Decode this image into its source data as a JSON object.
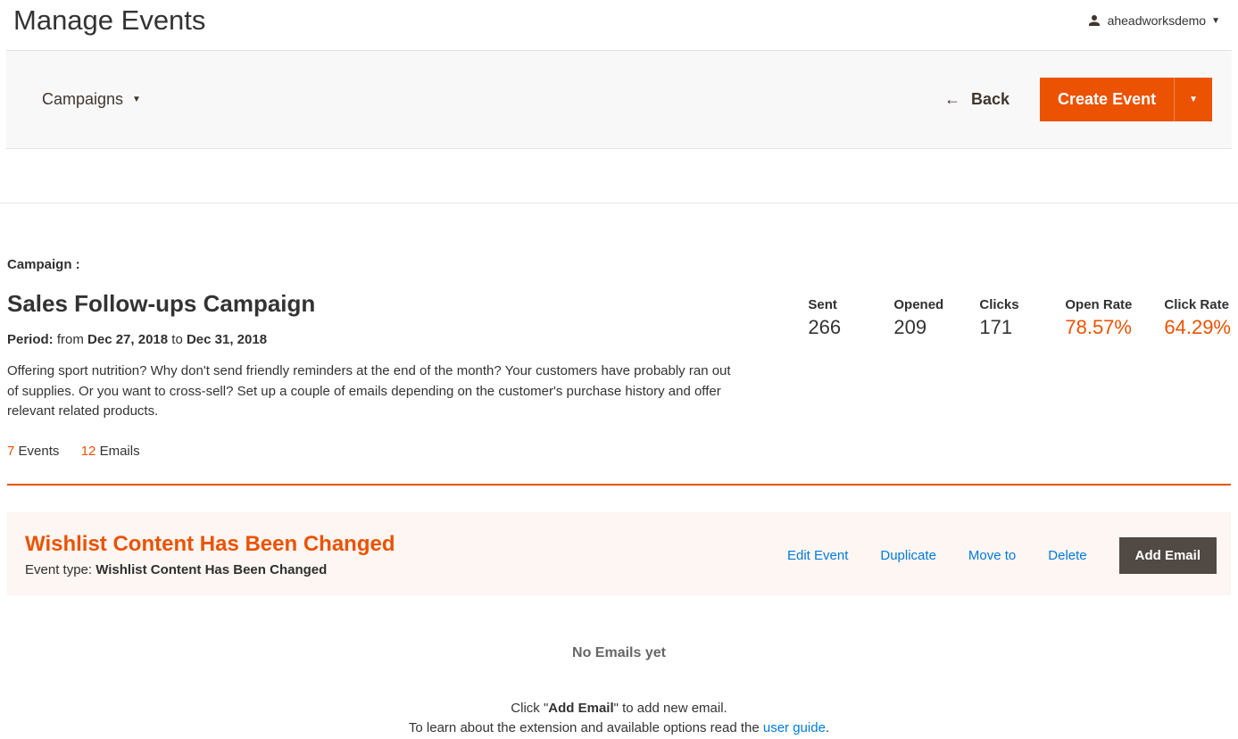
{
  "header": {
    "title": "Manage Events",
    "user": "aheadworksdemo"
  },
  "toolbar": {
    "campaigns_label": "Campaigns",
    "back_label": "Back",
    "create_label": "Create Event"
  },
  "campaign": {
    "label": "Campaign :",
    "name": "Sales Follow-ups Campaign",
    "period_label": "Period:",
    "period_from_word": "from",
    "period_from": "Dec 27, 2018",
    "period_to_word": "to",
    "period_to": "Dec 31, 2018",
    "description": "Offering sport nutrition? Why don't send friendly reminders at the end of the month? Your customers have probably ran out of supplies. Or you want to cross-sell? Set up a couple of emails depending on the customer's purchase history and offer relevant related products.",
    "events_count": "7",
    "events_word": "Events",
    "emails_count": "12",
    "emails_word": "Emails"
  },
  "stats": {
    "sent_label": "Sent",
    "sent_value": "266",
    "opened_label": "Opened",
    "opened_value": "209",
    "clicks_label": "Clicks",
    "clicks_value": "171",
    "open_rate_label": "Open Rate",
    "open_rate_value": "78.57%",
    "click_rate_label": "Click Rate",
    "click_rate_value": "64.29%"
  },
  "event": {
    "title": "Wishlist Content Has Been Changed",
    "type_label": "Event type:",
    "type_value": "Wishlist Content Has Been Changed",
    "actions": {
      "edit": "Edit Event",
      "duplicate": "Duplicate",
      "move": "Move to",
      "delete": "Delete",
      "add_email": "Add Email"
    }
  },
  "empty": {
    "no_emails": "No Emails yet",
    "hint_prefix": "Click \"",
    "hint_bold": "Add Email",
    "hint_suffix": "\" to add new email.",
    "hint2_prefix": "To learn about the extension and available options read the ",
    "hint2_link": "user guide",
    "hint2_suffix": "."
  }
}
